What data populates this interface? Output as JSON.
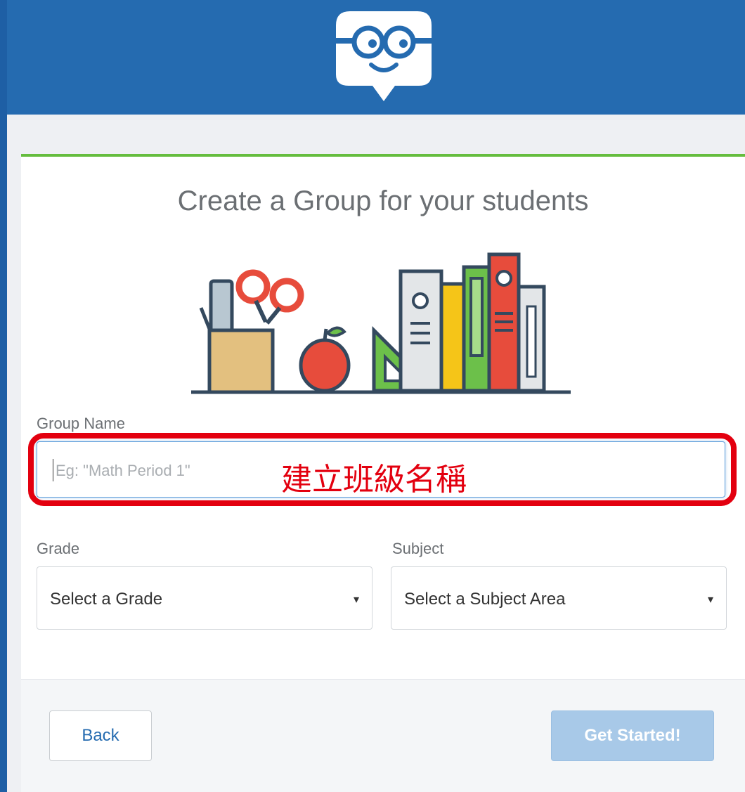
{
  "page": {
    "title": "Create a Group for your students"
  },
  "form": {
    "group_name_label": "Group Name",
    "group_name_placeholder": "Eg: \"Math Period 1\"",
    "group_name_value": "",
    "annotation_text": "建立班級名稱",
    "grade_label": "Grade",
    "grade_selected": "Select a Grade",
    "subject_label": "Subject",
    "subject_selected": "Select a Subject Area",
    "dropdown_arrow": "▾"
  },
  "footer": {
    "back_label": "Back",
    "start_label": "Get Started!"
  },
  "colors": {
    "header_blue": "#256bb0",
    "accent_green": "#65bd3e",
    "annotation_red": "#e3000f",
    "disabled_button": "#a8c9e8"
  },
  "icons": {
    "logo": "edmodo-face-logo",
    "illustration": "school-supplies-illustration"
  }
}
